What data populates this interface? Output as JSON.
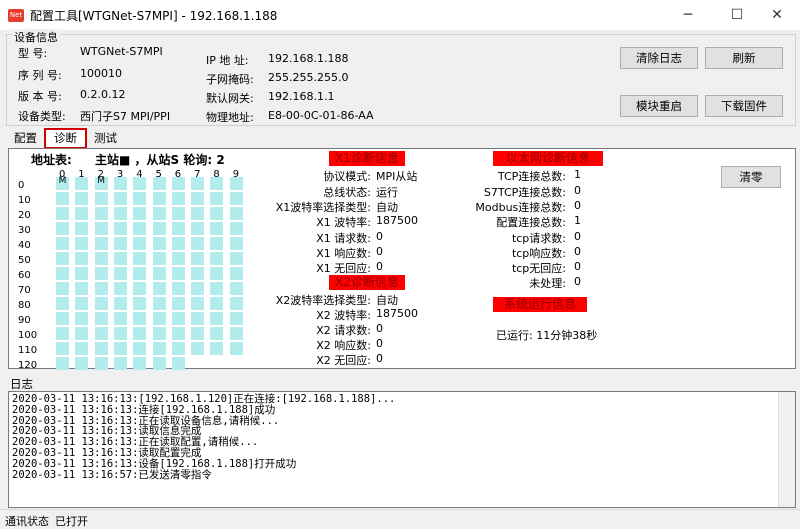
{
  "window": {
    "app_icon": "Net",
    "title": "配置工具[WTGNet-S7MPI] - 192.168.1.188",
    "minimize": "─",
    "maximize": "☐",
    "close": "✕"
  },
  "device_info": {
    "group_title": "设备信息",
    "model_label": "型    号:",
    "model_value": "WTGNet-S7MPI",
    "serial_label": "序 列 号:",
    "serial_value": "100010",
    "version_label": "版 本 号:",
    "version_value": "0.2.0.12",
    "devtype_label": "设备类型:",
    "devtype_value": "西门子S7 MPI/PPI",
    "ip_label": "IP 地 址:",
    "ip_value": "192.168.1.188",
    "mask_label": "子网掩码:",
    "mask_value": "255.255.255.0",
    "gw_label": "默认网关:",
    "gw_value": "192.168.1.1",
    "mac_label": "物理地址:",
    "mac_value": "E8-00-0C-01-86-AA"
  },
  "buttons": {
    "clear_log": "清除日志",
    "refresh": "刷新",
    "module_restart": "模块重启",
    "download_firmware": "下载固件",
    "clear_zero": "清零"
  },
  "tabs": [
    "配置",
    "诊断",
    "测试"
  ],
  "address_table": {
    "title": "地址表:",
    "legend": "主站■ ，从站S  轮询: 2",
    "columns": [
      "0",
      "1",
      "2",
      "3",
      "4",
      "5",
      "6",
      "7",
      "8",
      "9"
    ],
    "rows": [
      "0",
      "10",
      "20",
      "30",
      "40",
      "50",
      "60",
      "70",
      "80",
      "90",
      "100",
      "110",
      "120"
    ],
    "master_mark": "M",
    "masters": [
      0,
      2
    ]
  },
  "x1": {
    "header": "X1诊断信息",
    "protocol_label": "协议模式:",
    "protocol_value": "MPI从站",
    "bus_label": "总线状态:",
    "bus_value": "运行",
    "baudsel_label": "X1波特率选择类型:",
    "baudsel_value": "自动",
    "baud_label": "X1 波特率:",
    "baud_value": "187500",
    "req_label": "X1 请求数:",
    "req_value": "0",
    "resp_label": "X1 响应数:",
    "resp_value": "0",
    "noresp_label": "X1 无回应:",
    "noresp_value": "0"
  },
  "x2": {
    "header": "X2诊断信息",
    "baudsel_label": "X2波特率选择类型:",
    "baudsel_value": "自动",
    "baud_label": "X2 波特率:",
    "baud_value": "187500",
    "req_label": "X2 请求数:",
    "req_value": "0",
    "resp_label": "X2 响应数:",
    "resp_value": "0",
    "noresp_label": "X2 无回应:",
    "noresp_value": "0"
  },
  "eth": {
    "header": "以太网诊断信息",
    "tcp_total_label": "TCP连接总数:",
    "tcp_total_value": "1",
    "s7tcp_label": "S7TCP连接总数:",
    "s7tcp_value": "0",
    "modbus_label": "Modbus连接总数:",
    "modbus_value": "0",
    "config_label": "配置连接总数:",
    "config_value": "1",
    "tcpreq_label": "tcp请求数:",
    "tcpreq_value": "0",
    "tcpresp_label": "tcp响应数:",
    "tcpresp_value": "0",
    "tcpnoresp_label": "tcp无回应:",
    "tcpnoresp_value": "0",
    "unhandled_label": "未处理:",
    "unhandled_value": "0"
  },
  "system": {
    "header": "系统运行信息",
    "uptime": "已运行: 11分钟38秒"
  },
  "log": {
    "title": "日志",
    "lines": [
      "2020-03-11 13:16:13:[192.168.1.120]正在连接:[192.168.1.188]...",
      "2020-03-11 13:16:13:连接[192.168.1.188]成功",
      "2020-03-11 13:16:13:正在读取设备信息,请稍候...",
      "2020-03-11 13:16:13:读取信息完成",
      "2020-03-11 13:16:13:正在读取配置,请稍候...",
      "2020-03-11 13:16:13:读取配置完成",
      "2020-03-11 13:16:13:设备[192.168.1.188]打开成功",
      "2020-03-11 13:16:57:已发送清零指令"
    ]
  },
  "status": {
    "label": "通讯状态",
    "value": "已打开"
  },
  "colors": {
    "cell": "#b3ecec",
    "header_red": "#ff0000",
    "tab_highlight": "#d00000"
  }
}
